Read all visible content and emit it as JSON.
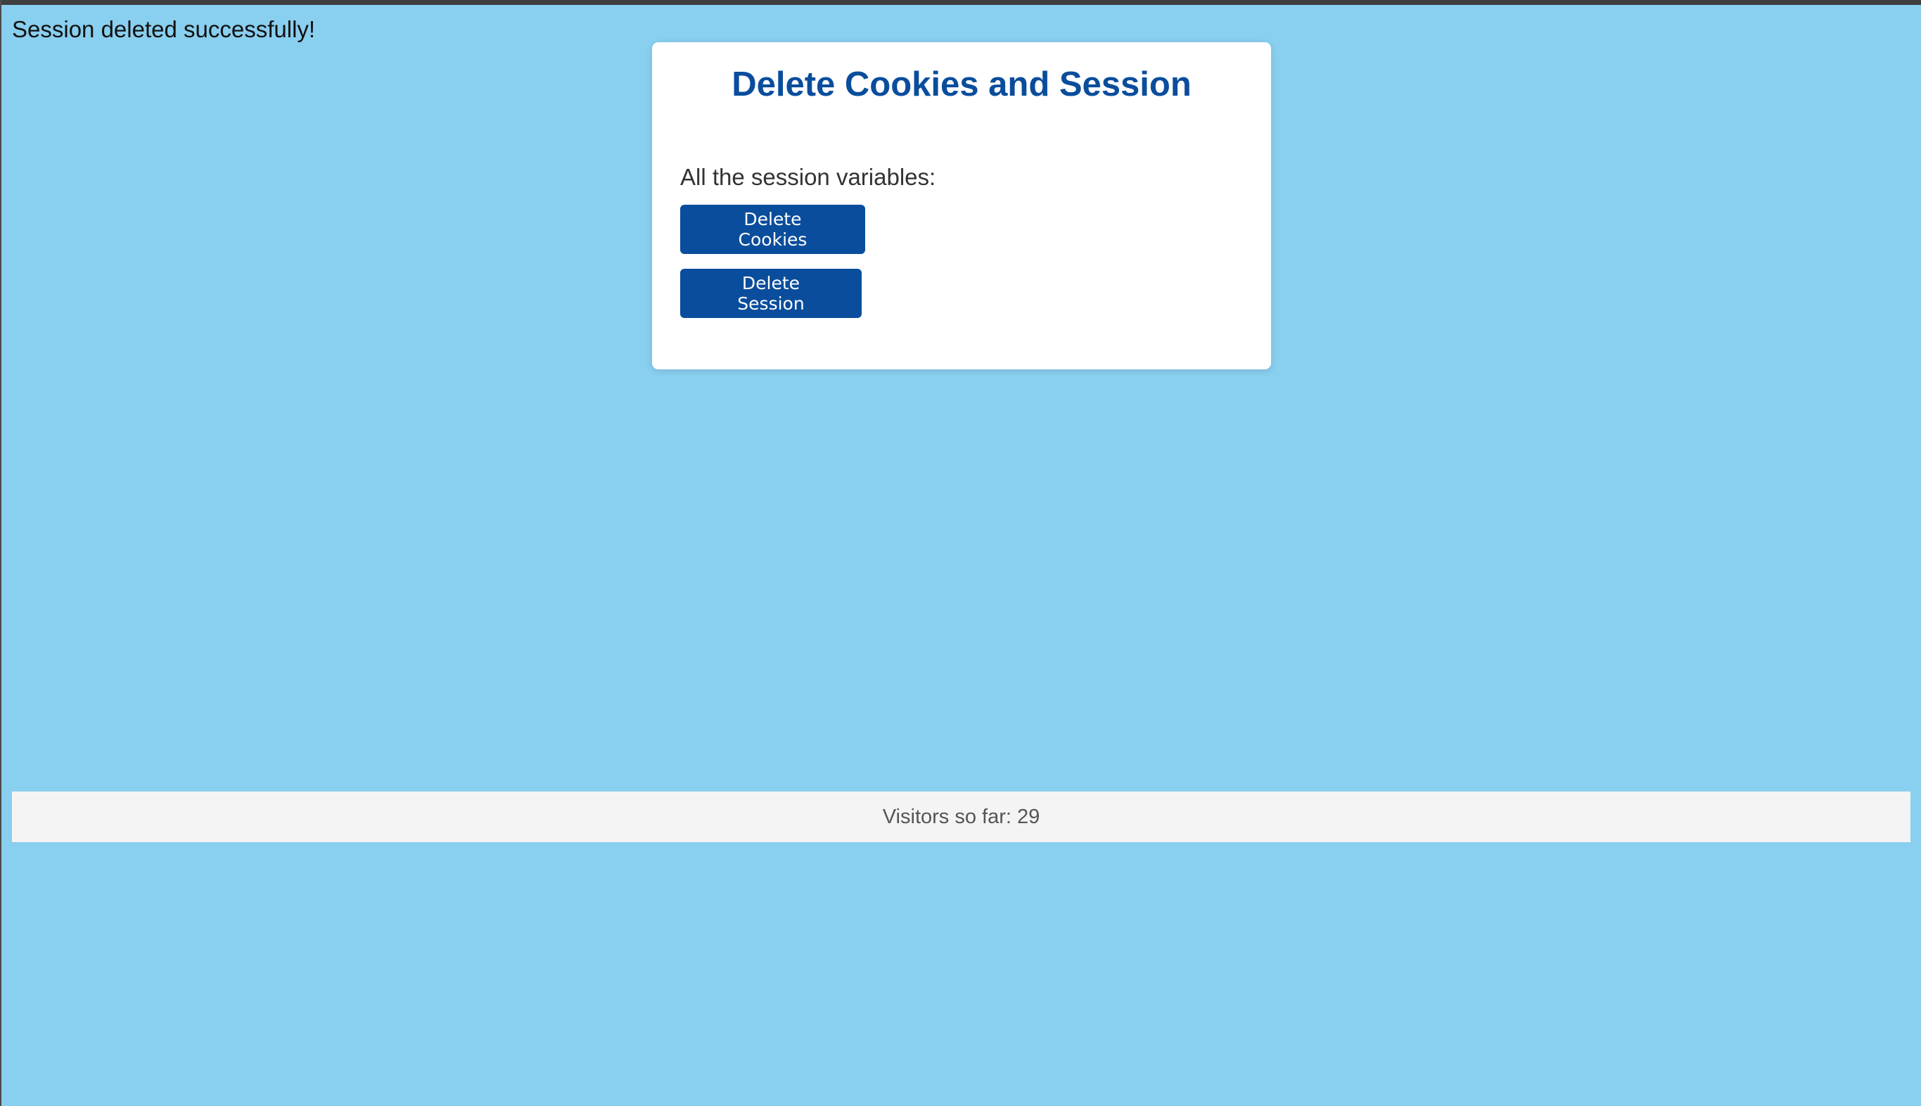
{
  "status": {
    "message": "Session deleted successfully!"
  },
  "card": {
    "title": "Delete Cookies and Session",
    "description": "All the session variables:",
    "buttons": {
      "delete_cookies": "Delete Cookies",
      "delete_session": "Delete Session"
    }
  },
  "footer": {
    "visitors_text": "Visitors so far: 29"
  },
  "colors": {
    "background": "#89CFEF",
    "accent": "#0A4D9C",
    "card": "#FFFFFF",
    "footer": "#F4F4F4"
  }
}
